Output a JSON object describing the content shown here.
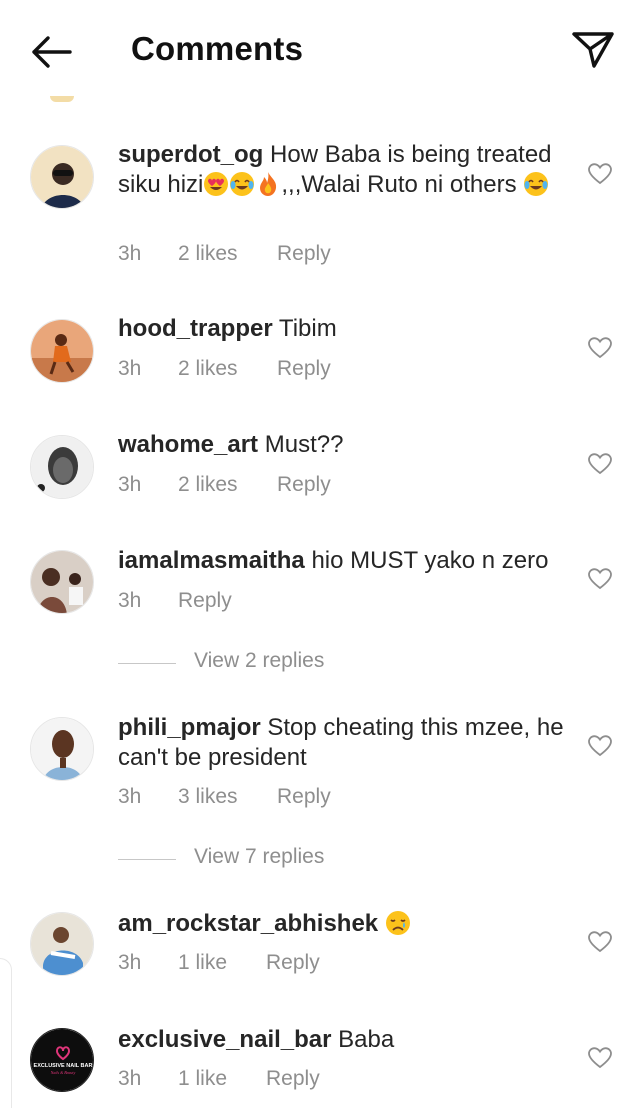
{
  "header": {
    "title": "Comments",
    "back_icon": "back-arrow-icon",
    "send_icon": "send-icon"
  },
  "comments": [
    {
      "username": "superdot_og",
      "text_a": "How Baba is being treated siku hizi",
      "text_b": ",,,Walai Ruto ni others",
      "emojis": [
        "heart-eyes-emoji",
        "joy-emoji",
        "fire-emoji",
        "joy-emoji"
      ],
      "time": "3h",
      "likes": "2 likes",
      "reply": "Reply"
    },
    {
      "username": "hood_trapper",
      "text": "Tibim",
      "time": "3h",
      "likes": "2 likes",
      "reply": "Reply"
    },
    {
      "username": "wahome_art",
      "text": "Must??",
      "time": "3h",
      "likes": "2 likes",
      "reply": "Reply"
    },
    {
      "username": "iamalmasmaitha",
      "text": "hio MUST yako n zero",
      "time": "3h",
      "reply": "Reply",
      "view_replies": "View 2 replies"
    },
    {
      "username": "phili_pmajor",
      "text": "Stop cheating this mzee, he can't be  president",
      "time": "3h",
      "likes": "3 likes",
      "reply": "Reply",
      "view_replies": "View 7 replies"
    },
    {
      "username": "am_rockstar_abhishek",
      "text": "",
      "emojis": [
        "crying-emoji"
      ],
      "time": "3h",
      "likes": "1 like",
      "reply": "Reply"
    },
    {
      "username": "exclusive_nail_bar",
      "text": "Baba",
      "time": "3h",
      "likes": "1 like",
      "reply": "Reply",
      "avatar_logo_text": "EXCLUSIVE NAIL BAR"
    }
  ],
  "icons": {
    "like": "heart-outline-icon"
  },
  "colors": {
    "text": "#262626",
    "meta": "#8e8e8e",
    "divider": "#c7c7c7",
    "background": "#ffffff"
  }
}
